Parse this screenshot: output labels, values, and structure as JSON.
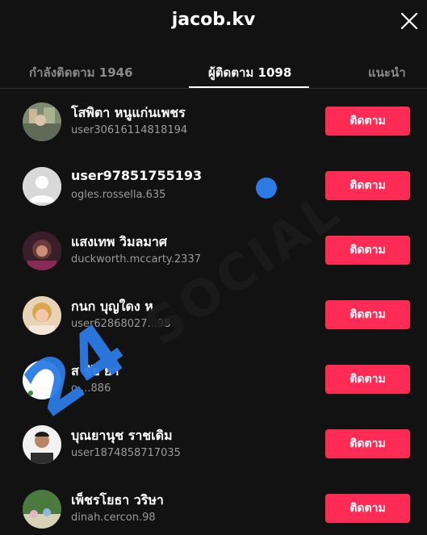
{
  "header": {
    "title": "jacob.kv",
    "close_icon": "close-icon"
  },
  "tabs": [
    {
      "label": "กำลังติดตาม 1946",
      "active": false
    },
    {
      "label": "ผู้ติดตาม 1098",
      "active": true
    },
    {
      "label": "แนะนำ",
      "active": false
    }
  ],
  "followers": [
    {
      "name": "โสพิตา หนูแก่นเพชร",
      "handle": "user30616114818194",
      "button": "ติดตาม",
      "avatar": "photo"
    },
    {
      "name": "user97851755193",
      "handle": "ogles.rossella.635",
      "button": "ติดตาม",
      "avatar": "default"
    },
    {
      "name": "แสงเทพ วิมลมาศ",
      "handle": "duckworth.mccarty.2337",
      "button": "ติดตาม",
      "avatar": "photo"
    },
    {
      "name": "กนก บุญใดง ห",
      "handle": "user62868027...98",
      "button": "ติดตาม",
      "avatar": "photo"
    },
    {
      "name": "ส   ชัย   ยา",
      "handle": "o         ...886",
      "button": "ติดตาม",
      "avatar": "photo"
    },
    {
      "name": "บุณยานุช ราชเดิม",
      "handle": "user1874858717035",
      "button": "ติดตาม",
      "avatar": "photo"
    },
    {
      "name": "เพ็ชรโยธา วริษา",
      "handle": "dinah.cercon.98",
      "button": "ติดตาม",
      "avatar": "photo"
    }
  ],
  "watermark": {
    "number": "24",
    "text": "SOCIAL",
    "color": "#2c7be5"
  },
  "colors": {
    "background": "#121212",
    "follow_button": "#fe2c55",
    "tab_inactive": "#8a8a8a",
    "handle": "#9a9a9a"
  }
}
